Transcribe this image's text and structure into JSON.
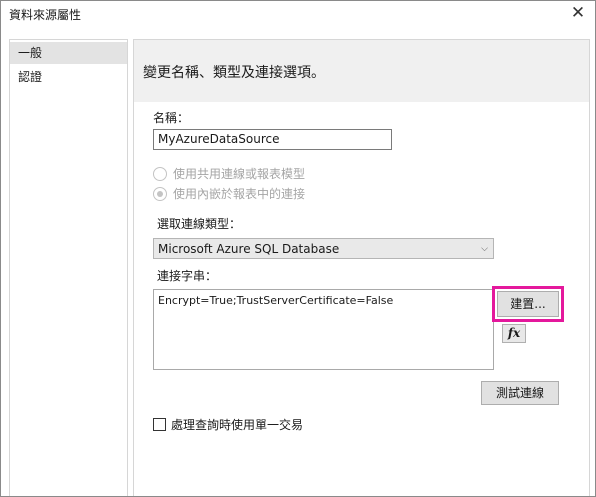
{
  "window": {
    "title": "資料來源屬性",
    "close_glyph": "✕"
  },
  "nav": {
    "items": [
      {
        "label": "一般",
        "selected": true
      },
      {
        "label": "認證",
        "selected": false
      }
    ]
  },
  "general": {
    "banner": "變更名稱、類型及連接選項。",
    "name_label": "名稱：",
    "name_value": "MyAzureDataSource",
    "radio_shared": {
      "label": "使用共用連線或報表模型",
      "checked": false,
      "enabled": false
    },
    "radio_embedded": {
      "label": "使用內嵌於報表中的連接",
      "checked": true,
      "enabled": false
    },
    "connection_type_label": "選取連線類型：",
    "connection_type_value": "Microsoft Azure SQL Database",
    "connection_string_label": "連接字串：",
    "connection_string_value": "Encrypt=True;TrustServerCertificate=False",
    "build_button": "建置...",
    "fx_button": "fx",
    "test_button": "測試連線",
    "single_transaction": {
      "label": "處理查詢時使用單一交易",
      "checked": false
    }
  },
  "colors": {
    "highlight": "#e4189c",
    "banner_bg": "#f0f0f0",
    "nav_selected_bg": "#e3e3e3"
  },
  "icons": {
    "close": "close-icon",
    "dropdown": "chevron-down-icon",
    "expression": "function-fx-icon"
  }
}
